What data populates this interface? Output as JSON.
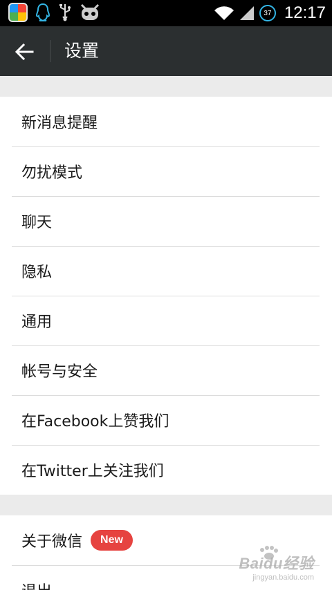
{
  "status_bar": {
    "time": "12:17",
    "battery_level": "37",
    "icons": [
      "app-store-icon",
      "qq-penguin-icon",
      "usb-icon",
      "android-debug-icon",
      "wifi-icon",
      "signal-icon",
      "battery-icon"
    ],
    "accent": "#33b5e5"
  },
  "toolbar": {
    "title": "设置",
    "background": "#2b2f30"
  },
  "settings_group_1": [
    {
      "label": "新消息提醒"
    },
    {
      "label": "勿扰模式"
    },
    {
      "label": "聊天"
    },
    {
      "label": "隐私"
    },
    {
      "label": "通用"
    },
    {
      "label": "帐号与安全"
    },
    {
      "label": "在Facebook上赞我们"
    },
    {
      "label": "在Twitter上关注我们"
    }
  ],
  "settings_group_2": [
    {
      "label": "关于微信",
      "badge": "New"
    },
    {
      "label": "退出"
    }
  ],
  "badge_color": "#e64340",
  "watermark": {
    "main": "Baidu经验",
    "sub": "jingyan.baidu.com"
  }
}
